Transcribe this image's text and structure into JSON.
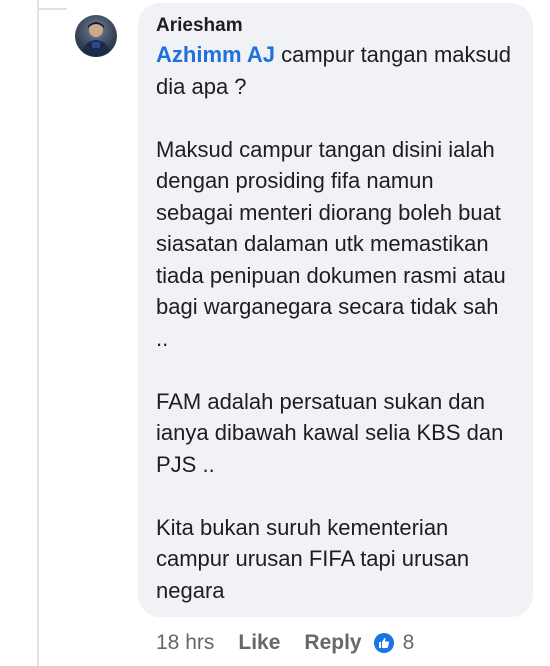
{
  "comment": {
    "author": "Ariesham",
    "mention": "Azhimm AJ",
    "first_line_rest": " campur tangan maksud dia apa ?",
    "paragraphs": [
      "Maksud campur tangan disini ialah dengan prosiding fifa namun sebagai menteri diorang boleh buat siasatan dalaman utk memastikan tiada penipuan dokumen rasmi atau bagi warganegara secara tidak sah ..",
      "FAM adalah persatuan sukan dan ianya dibawah kawal selia KBS dan PJS ..",
      "Kita bukan suruh kementerian campur urusan FIFA tapi urusan negara"
    ]
  },
  "actions": {
    "time": "18 hrs",
    "like_label": "Like",
    "reply_label": "Reply",
    "reaction_icon": "like-icon",
    "reaction_count": "8"
  },
  "colors": {
    "bubble_bg": "#f0f2f5",
    "mention": "#216fdb",
    "meta_text": "#65676b",
    "like_blue": "#1b74e4"
  }
}
